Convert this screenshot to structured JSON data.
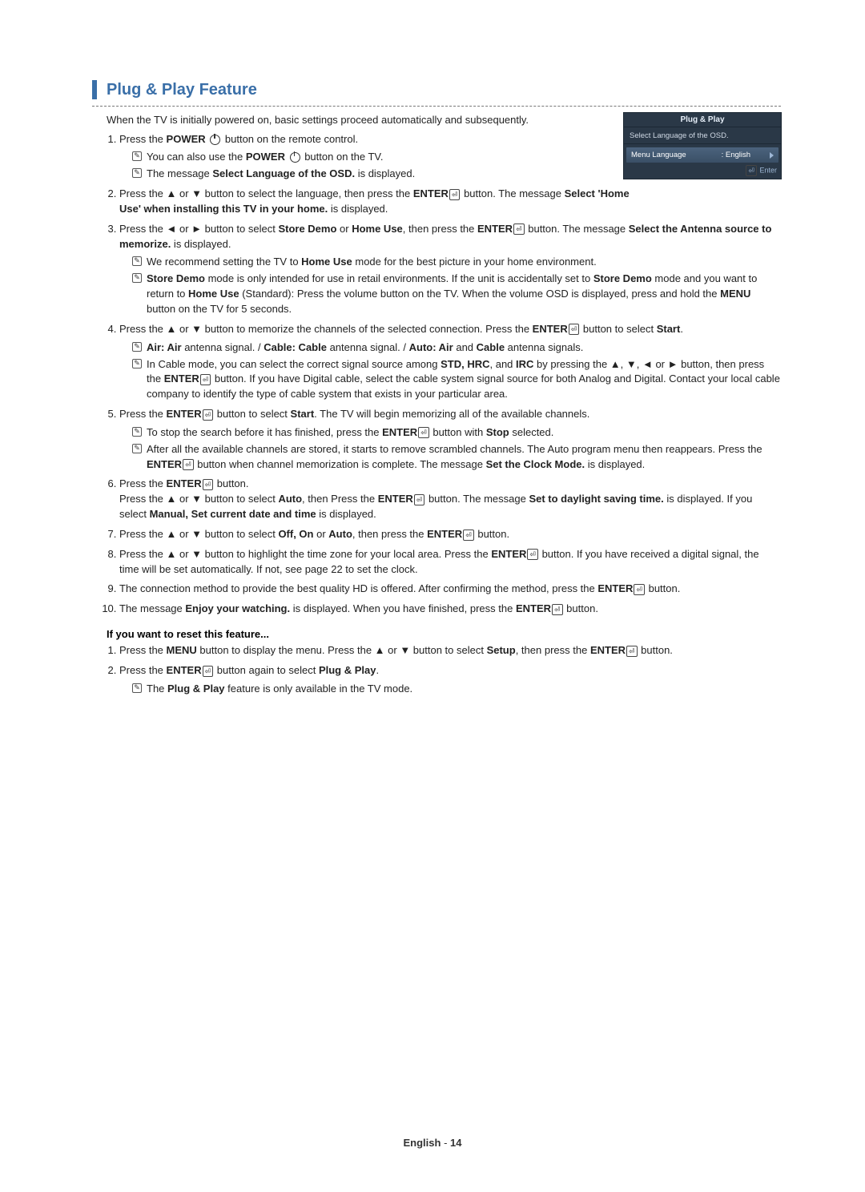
{
  "section_title": "Plug & Play Feature",
  "intro": "When the TV is initially powered on, basic settings proceed automatically and subsequently.",
  "steps": [
    {
      "text_before": "Press the ",
      "bold1": "POWER",
      "text_mid": " button on the remote control.",
      "notes": [
        {
          "pre": "You can also use the ",
          "bold1": "POWER",
          "post": " button on the TV."
        },
        {
          "pre": "The message ",
          "bold1": "Select Language of the OSD.",
          "post": " is displayed."
        }
      ]
    },
    {
      "text": "Press the ▲ or ▼ button to select the language, then press the ",
      "bold_enter": true,
      "tail": " button. The message ",
      "bold_tail": "Select 'Home Use' when installing this TV in your home.",
      "tail2": " is displayed."
    },
    {
      "line1_pre": "Press the ◄ or ► button to select ",
      "line1_b1": "Store Demo",
      "line1_mid": " or ",
      "line1_b2": "Home Use",
      "line1_post": ", then press the ",
      "line1_enter": true,
      "line1_tail": " button. The message ",
      "line1_b3": "Select the Antenna source to memorize.",
      "line1_end": " is displayed.",
      "notes": [
        {
          "pre": "We recommend setting the TV to ",
          "bold1": "Home Use",
          "post": " mode for the best picture in your home environment."
        },
        {
          "bold1": "Store Demo",
          "mid": " mode is only intended for use in retail environments. If the unit is accidentally set to ",
          "bold2": "Store Demo",
          "mid2": " mode and you want to return to ",
          "bold3": "Home Use",
          "post": " (Standard): Press the volume button on the TV. When the volume OSD is displayed, press and hold the ",
          "bold4": "MENU",
          "post2": " button on the TV for 5 seconds."
        }
      ]
    },
    {
      "line_pre": "Press the ▲ or ▼ button to memorize the channels of the selected connection. Press the ",
      "enter": true,
      "line_post": " button to select ",
      "bold_start": "Start",
      "line_end": ".",
      "notes": [
        {
          "bold1": "Air: Air",
          "mid": " antenna signal. / ",
          "bold2": "Cable: Cable",
          "mid2": " antenna signal. / ",
          "bold3": "Auto: Air",
          "mid3": " and ",
          "bold4": "Cable",
          "post": " antenna signals."
        },
        {
          "pre": "In Cable mode, you can select the correct signal source among ",
          "bold1": "STD, HRC",
          "mid": ", and ",
          "bold2": "IRC",
          "post": " by pressing the ▲, ▼, ◄ or ► button, then press the ",
          "enter": true,
          "post2": " button. If you have Digital cable, select the cable system signal source for both Analog and Digital. Contact your local cable company to identify the type of cable system that exists in your particular area."
        }
      ]
    },
    {
      "line_pre": "Press the ",
      "enter": true,
      "line_post": " button to select ",
      "bold_start": "Start",
      "line_end": ". The TV will begin memorizing all of the available channels.",
      "notes": [
        {
          "pre": "To stop the search before it has finished, press the ",
          "enter": true,
          "mid": " button with ",
          "bold1": "Stop",
          "post": " selected."
        },
        {
          "pre": "After all the available channels are stored, it starts to remove scrambled channels. The Auto program menu then reappears. Press the ",
          "enter": true,
          "mid": " button when channel memorization is complete. The message ",
          "bold1": "Set the Clock Mode.",
          "post": " is displayed."
        }
      ]
    },
    {
      "line_pre": "Press the ",
      "enter": true,
      "line_post": " button.",
      "para2_pre": "Press the ▲ or ▼ button to select ",
      "para2_b1": "Auto",
      "para2_mid": ", then Press the ",
      "para2_enter": true,
      "para2_mid2": " button. The message ",
      "para2_b2": "Set to daylight saving time.",
      "para2_mid3": " is displayed. If you select ",
      "para2_b3": "Manual, Set current date and time",
      "para2_end": " is displayed."
    },
    {
      "line_pre": "Press the ▲ or ▼ button to select ",
      "b1": "Off, On",
      "mid": " or ",
      "b2": "Auto",
      "post": ", then press the ",
      "enter": true,
      "end": " button."
    },
    {
      "line_pre": "Press the ▲ or ▼ button to highlight the time zone for your local area. Press the ",
      "enter": true,
      "post": " button. If you have received a digital signal, the time will be set automatically. If not, see page 22 to set the clock."
    },
    {
      "line_pre": "The connection method to provide the best quality HD is offered. After confirming the method, press the ",
      "enter": true,
      "post": " button."
    },
    {
      "line_pre": "The message ",
      "b1": "Enjoy your watching.",
      "mid": " is displayed. When you have finished, press the ",
      "enter": true,
      "post": " button."
    }
  ],
  "reset_heading": "If you want to reset this feature...",
  "reset_steps": [
    {
      "pre": "Press the ",
      "b1": "MENU",
      "mid": " button to display the menu. Press the ▲ or ▼ button to select ",
      "b2": "Setup",
      "mid2": ", then press the ",
      "enter": true,
      "post": " button."
    },
    {
      "pre": "Press the ",
      "enter": true,
      "mid": " button again to select ",
      "b1": "Plug & Play",
      "post": ".",
      "notes": [
        {
          "pre": "The ",
          "bold1": "Plug & Play",
          "post": " feature is only available in the TV mode."
        }
      ]
    }
  ],
  "osd": {
    "title": "Plug & Play",
    "line1": "Select Language of the OSD.",
    "row_label": "Menu Language",
    "row_value": ": English",
    "footer": "Enter"
  },
  "footer": {
    "lang": "English",
    "sep": " - ",
    "page": "14"
  }
}
